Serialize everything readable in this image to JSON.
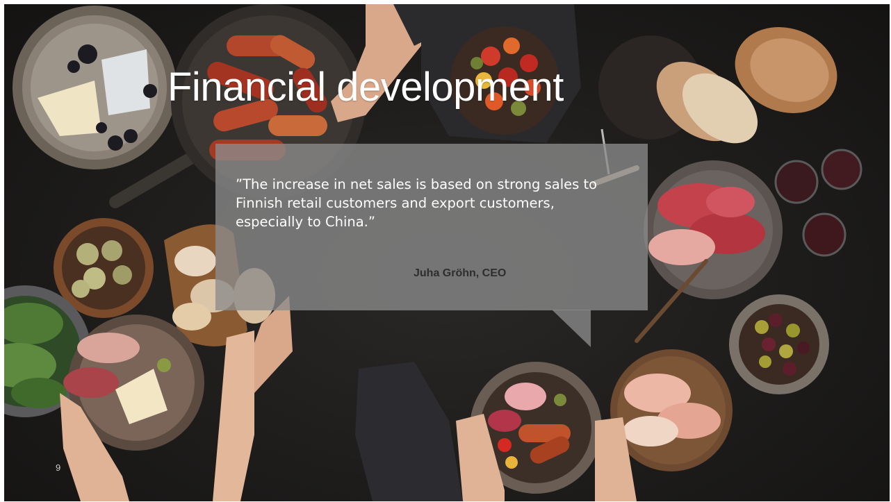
{
  "slide": {
    "title": "Financial development",
    "quote": "”The increase in net sales is based on strong sales to Finnish retail customers and export customers, especially to China.”",
    "author": "Juha Gröhn, CEO",
    "page_number": "9"
  },
  "colors": {
    "background": "#1c1b1a",
    "title_text": "#ffffff",
    "bubble_fill": "#8c8c8c",
    "author_text": "#2e2e2e"
  },
  "icons": {
    "background_image": "food-spread-photo"
  }
}
